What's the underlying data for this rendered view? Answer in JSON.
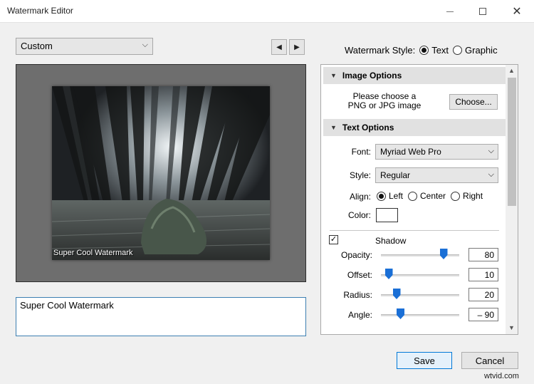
{
  "window": {
    "title": "Watermark Editor"
  },
  "preset": {
    "selected": "Custom"
  },
  "watermark_style": {
    "label": "Watermark Style:",
    "options": [
      {
        "label": "Text",
        "selected": true
      },
      {
        "label": "Graphic",
        "selected": false
      }
    ]
  },
  "preview": {
    "watermark_text": "Super Cool Watermark"
  },
  "text_input": {
    "value": "Super Cool Watermark"
  },
  "image_options": {
    "header": "Image Options",
    "message": "Please choose a PNG or JPG image",
    "choose_label": "Choose..."
  },
  "text_options": {
    "header": "Text Options",
    "font_label": "Font:",
    "font_value": "Myriad Web Pro",
    "style_label": "Style:",
    "style_value": "Regular",
    "align_label": "Align:",
    "align_options": [
      {
        "label": "Left",
        "selected": true
      },
      {
        "label": "Center",
        "selected": false
      },
      {
        "label": "Right",
        "selected": false
      }
    ],
    "color_label": "Color:",
    "color_value": "#ffffff"
  },
  "shadow": {
    "enabled": true,
    "label": "Shadow",
    "check_glyph": "✓",
    "sliders": [
      {
        "label": "Opacity:",
        "value": "80",
        "min": 0,
        "max": 100,
        "position": 80
      },
      {
        "label": "Offset:",
        "value": "10",
        "min": 0,
        "max": 100,
        "position": 10
      },
      {
        "label": "Radius:",
        "value": "20",
        "min": 0,
        "max": 100,
        "position": 20
      },
      {
        "label": "Angle:",
        "value": "– 90",
        "min": -180,
        "max": 180,
        "position": -90
      }
    ]
  },
  "buttons": {
    "save": "Save",
    "cancel": "Cancel"
  },
  "watermark_brand": "wtvid.com",
  "colors": {
    "accent": "#1a6fd6",
    "focus_border": "#0078d7",
    "preview_bg": "#6e6e6e"
  }
}
